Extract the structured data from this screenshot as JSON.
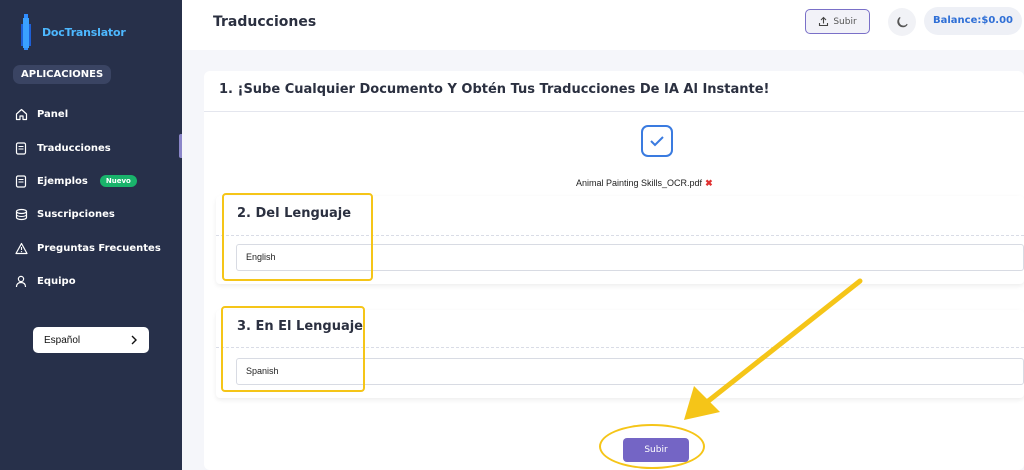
{
  "brand": {
    "name": "DocTranslator"
  },
  "sidebar": {
    "section_label": "APLICACIONES",
    "items": [
      {
        "label": "Panel",
        "icon": "home-icon"
      },
      {
        "label": "Traducciones",
        "icon": "document-icon",
        "active": true
      },
      {
        "label": "Ejemplos",
        "icon": "document-icon",
        "badge": "Nuevo"
      },
      {
        "label": "Suscripciones",
        "icon": "box-icon"
      },
      {
        "label": "Preguntas Frecuentes",
        "icon": "warning-icon"
      },
      {
        "label": "Equipo",
        "icon": "user-icon"
      }
    ],
    "language": "Español"
  },
  "header": {
    "title": "Traducciones",
    "upload_label": "Subir",
    "balance": "Balance:$0.00"
  },
  "main": {
    "step1_title": "1. ¡Sube Cualquier Documento Y Obtén Tus Traducciones De IA Al Instante!",
    "file_name": "Animal Painting Skills_OCR.pdf",
    "remove_symbol": "✖",
    "from_title": "2. Del Lenguaje",
    "from_value": "English",
    "to_title": "3. En El Lenguaje",
    "to_value": "Spanish",
    "submit_label": "Subir"
  },
  "colors": {
    "sidebar_bg": "#27304a",
    "accent": "#7465c5",
    "highlight": "#f5c518",
    "brand": "#4db8ff"
  }
}
